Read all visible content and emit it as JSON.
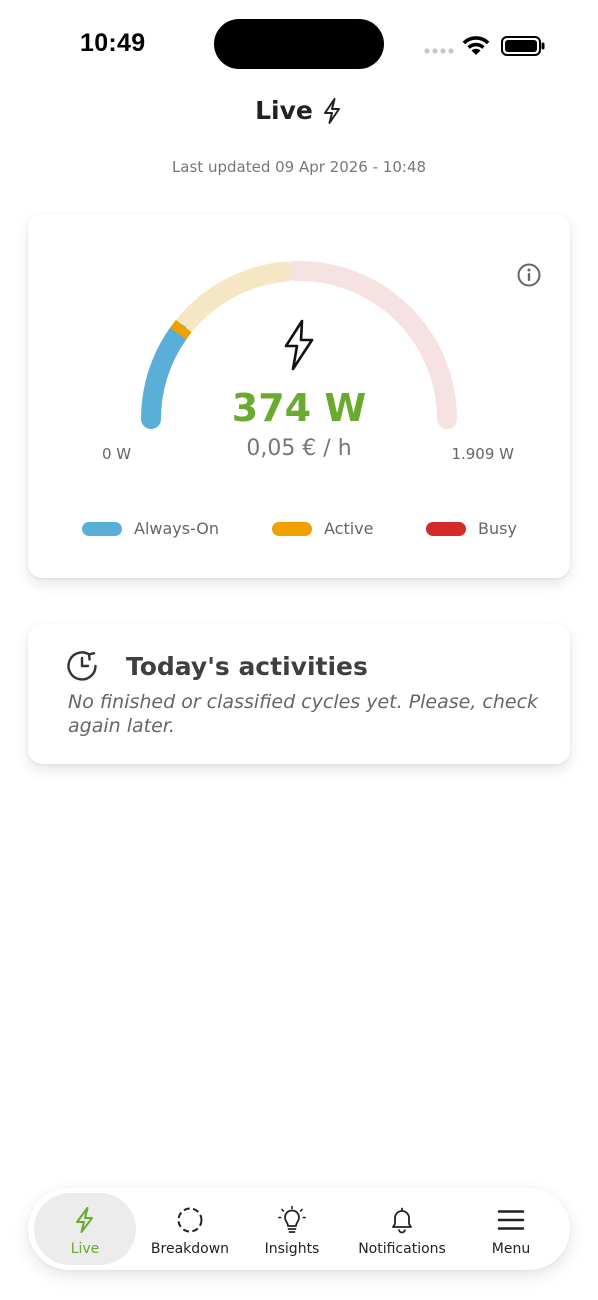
{
  "status_bar": {
    "time": "10:49"
  },
  "header": {
    "title": "Live",
    "title_icon": "lightning-bolt-icon",
    "last_updated": "Last updated 09 Apr 2026 - 10:48"
  },
  "gauge": {
    "power": "374 W",
    "cost": "0,05 € / h",
    "min_label": "0 W",
    "max_label": "1.909 W",
    "current_value_w": 374,
    "max_value_w": 1909,
    "center_icon": "lightning-bolt-icon",
    "info_icon": "info-icon",
    "colors": {
      "always_on": "#5aafd9",
      "active": "#f0a000",
      "busy": "#d42a2a",
      "active_zone_faded": "#f5e7c4",
      "busy_zone_faded": "#f6e2e2",
      "power_value": "#6aaa2f"
    }
  },
  "legend": [
    {
      "label": "Always-On",
      "color": "#5aafd9"
    },
    {
      "label": "Active",
      "color": "#f0a000"
    },
    {
      "label": "Busy",
      "color": "#d42a2a"
    }
  ],
  "activities": {
    "title": "Today's activities",
    "icon": "clock-history-icon",
    "message": "No finished or classified cycles yet. Please, check again later."
  },
  "bottom_nav": [
    {
      "label": "Live",
      "icon": "lightning-bolt-icon",
      "active": true
    },
    {
      "label": "Breakdown",
      "icon": "dashed-circle-icon",
      "active": false
    },
    {
      "label": "Insights",
      "icon": "lightbulb-icon",
      "active": false
    },
    {
      "label": "Notifications",
      "icon": "bell-icon",
      "active": false
    },
    {
      "label": "Menu",
      "icon": "hamburger-menu-icon",
      "active": false
    }
  ]
}
